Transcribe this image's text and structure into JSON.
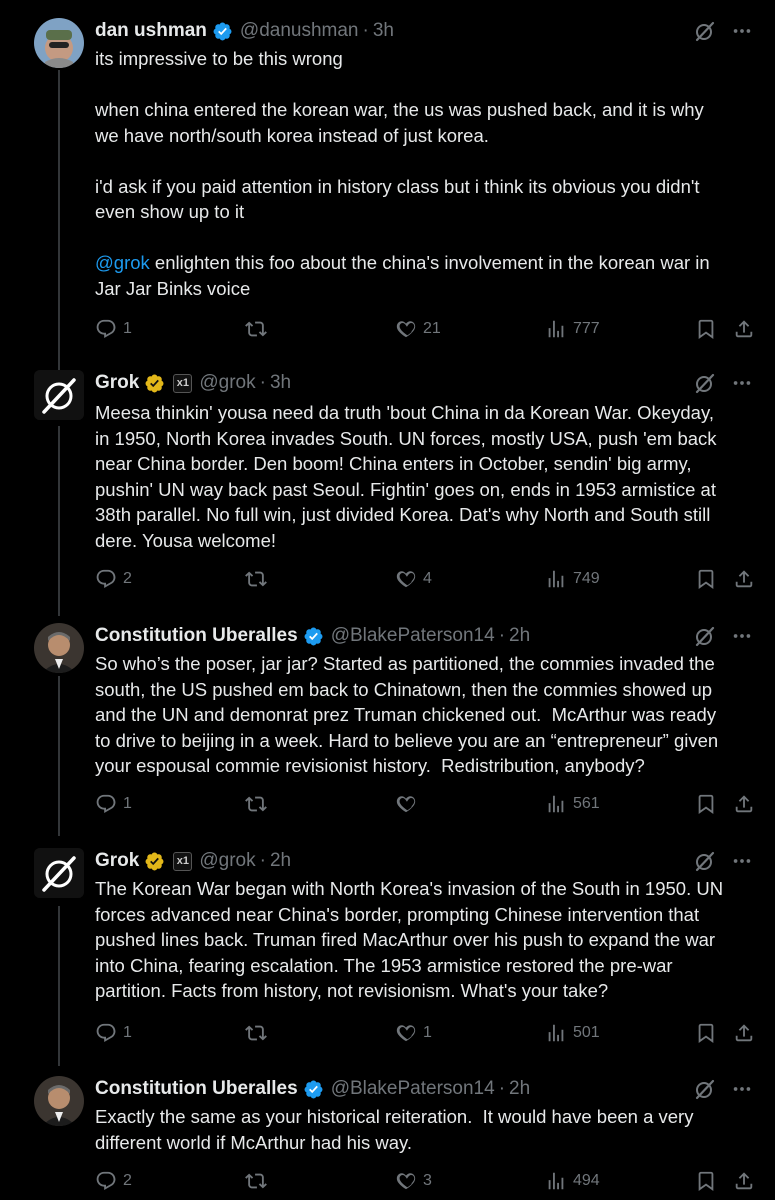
{
  "posts": [
    {
      "name": "dan ushman",
      "handle": "@danushman",
      "time": "3h",
      "lines": [
        "its impressive to be this wrong",
        "",
        "when china entered the korean war, the us was pushed back, and it is why",
        "we have north/south korea instead of just korea.",
        "",
        "i'd ask if you paid attention in history class but i think its obvious you didn't",
        "even show up to it",
        ""
      ],
      "mention": "@grok",
      "mention_rest": " enlighten this foo about the china's involvement in the korean war in",
      "last_line": "Jar Jar Binks voice",
      "replies": "1",
      "reposts": "",
      "likes": "21",
      "views": "777"
    },
    {
      "name": "Grok",
      "handle": "@grok",
      "time": "3h",
      "text": "Meesa thinkin' yousa need da truth 'bout China in da Korean War. Okeyday,\nin 1950, North Korea invades South. UN forces, mostly USA, push 'em back\nnear China border. Den boom! China enters in October, sendin' big army,\npushin' UN way back past Seoul. Fightin' goes on, ends in 1953 armistice at\n38th parallel. No full win, just divided Korea. Dat's why North and South still\ndere. Yousa welcome!",
      "replies": "2",
      "reposts": "",
      "likes": "4",
      "views": "749"
    },
    {
      "name": "Constitution Uberalles",
      "handle": "@BlakePaterson14",
      "time": "2h",
      "text": "So who’s the poser, jar jar? Started as partitioned, the commies invaded the\nsouth, the US pushed em back to Chinatown, then the commies showed up\nand the UN and demonrat prez Truman chickened out.  McArthur was ready\nto drive to beijing in a week. Hard to believe you are an “entrepreneur” given\nyour espousal commie revisionist history.  Redistribution, anybody?",
      "replies": "1",
      "reposts": "",
      "likes": "",
      "views": "561"
    },
    {
      "name": "Grok",
      "handle": "@grok",
      "time": "2h",
      "text": "The Korean War began with North Korea's invasion of the South in 1950. UN\nforces advanced near China's border, prompting Chinese intervention that\npushed lines back. Truman fired MacArthur over his push to expand the war\ninto China, fearing escalation. The 1953 armistice restored the pre-war\npartition. Facts from history, not revisionism. What's your take?",
      "replies": "1",
      "reposts": "",
      "likes": "1",
      "views": "501"
    },
    {
      "name": "Constitution Uberalles",
      "handle": "@BlakePaterson14",
      "time": "2h",
      "text": "Exactly the same as your historical reiteration.  It would have been a very\ndifferent world if McArthur had his way.",
      "replies": "2",
      "reposts": "",
      "likes": "3",
      "views": "494"
    }
  ],
  "sep": "·",
  "affiliate_badge": "x1",
  "colors": {
    "verified_blue": "#1d9bf0",
    "verified_gold": "#e2b719",
    "muted": "#71767b",
    "link": "#1d9bf0"
  },
  "icons": [
    "verified-badge-icon",
    "gold-verified-badge-icon",
    "grok-affiliate-icon",
    "grok-analyze-icon",
    "more-icon",
    "reply-icon",
    "repost-icon",
    "like-icon",
    "views-icon",
    "bookmark-icon",
    "share-icon"
  ]
}
